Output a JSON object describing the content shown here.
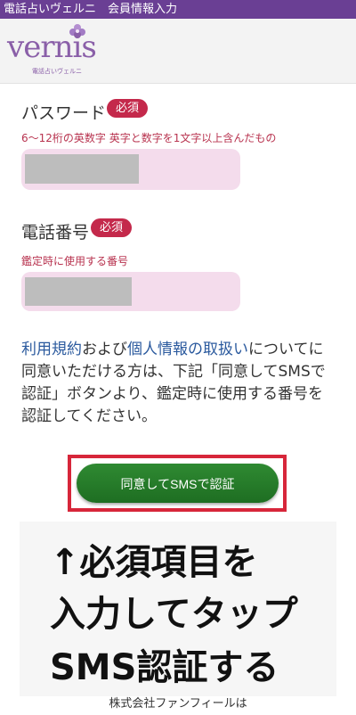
{
  "topbar": {
    "title": "電話占いヴェルニ　会員情報入力",
    "color": "#6a3f94"
  },
  "header": {
    "logo_word": "vernis",
    "logo_sub": "電話占いヴェルニ"
  },
  "password": {
    "label": "パスワード",
    "badge": "必須",
    "hint": "6〜12桁の英数字 英字と数字を1文字以上含んだもの"
  },
  "phone": {
    "label": "電話番号",
    "badge": "必須",
    "hint": "鑑定時に使用する番号"
  },
  "terms": {
    "link_terms": "利用規約",
    "and": "および",
    "link_privacy": "個人情報の取扱い",
    "rest": "についてに同意いただける方は、下記「同意してSMSで認証」ボタンより、鑑定時に使用する番号を認証してください。"
  },
  "agree_button": {
    "label": "同意してSMSで認証",
    "color": "#2f8a32"
  },
  "callout": {
    "line1": "↑必須項目を",
    "line2": "入力してタップ",
    "line3": "SMS認証する"
  },
  "footer": {
    "text": "株式会社ファンフィールは"
  },
  "colors": {
    "badge": "#c4294b",
    "input_bg": "#f4dcec",
    "frame": "#d7263a",
    "link": "#2b5a9e"
  }
}
